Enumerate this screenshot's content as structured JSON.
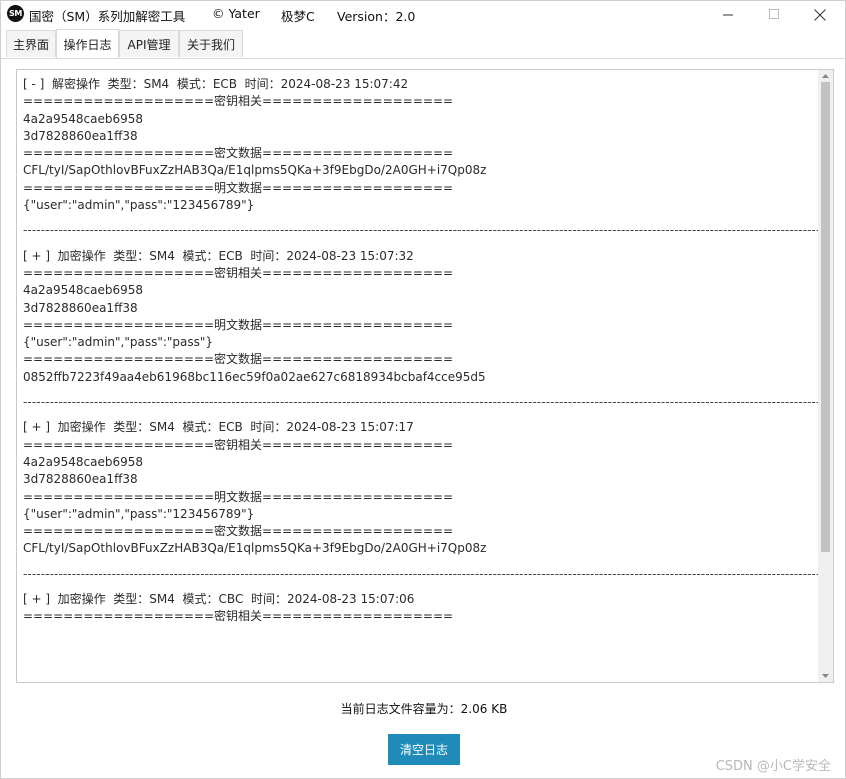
{
  "titlebar": {
    "app_icon_text": "SM",
    "app_name": "国密（SM）系列加解密工具",
    "copyright": "© Yater",
    "author": "极梦C",
    "version": "Version：2.0",
    "minimize_icon": "minimize-icon",
    "maximize_icon": "maximize-icon",
    "close_icon": "close-icon"
  },
  "tabs": [
    {
      "label": "主界面",
      "active": false
    },
    {
      "label": "操作日志",
      "active": true
    },
    {
      "label": "API管理",
      "active": false
    },
    {
      "label": "关于我们",
      "active": false
    }
  ],
  "log": {
    "separator": "------------------------------------------------------------------------------------------------------------------------------------------------------------------------------------------------------------",
    "entries": [
      {
        "lines": [
          "[ - ]  解密操作  类型：SM4  模式：ECB  时间：2024-08-23 15:07:42",
          "===================密钥相关===================",
          "4a2a9548caeb6958",
          "3d7828860ea1ff38",
          "===================密文数据===================",
          "CFL/tyI/SapOthlovBFuxZzHAB3Qa/E1qlpms5QKa+3f9EbgDo/2A0GH+i7Qp08z",
          "===================明文数据===================",
          "{\"user\":\"admin\",\"pass\":\"123456789\"}"
        ]
      },
      {
        "lines": [
          "[ + ]  加密操作  类型：SM4  模式：ECB  时间：2024-08-23 15:07:32",
          "===================密钥相关===================",
          "4a2a9548caeb6958",
          "3d7828860ea1ff38",
          "===================明文数据===================",
          "{\"user\":\"admin\",\"pass\":\"pass\"}",
          "===================密文数据===================",
          "0852ffb7223f49aa4eb61968bc116ec59f0a02ae627c6818934bcbaf4cce95d5"
        ]
      },
      {
        "lines": [
          "[ + ]  加密操作  类型：SM4  模式：ECB  时间：2024-08-23 15:07:17",
          "===================密钥相关===================",
          "4a2a9548caeb6958",
          "3d7828860ea1ff38",
          "===================明文数据===================",
          "{\"user\":\"admin\",\"pass\":\"123456789\"}",
          "===================密文数据===================",
          "CFL/tyI/SapOthlovBFuxZzHAB3Qa/E1qlpms5QKa+3f9EbgDo/2A0GH+i7Qp08z"
        ]
      },
      {
        "lines": [
          "[ + ]  加密操作  类型：SM4  模式：CBC  时间：2024-08-23 15:07:06",
          "===================密钥相关==================="
        ]
      }
    ]
  },
  "status": {
    "log_size_text": "当前日志文件容量为：2.06 KB"
  },
  "buttons": {
    "clear_log": "清空日志"
  },
  "watermark": "CSDN @小C学安全"
}
